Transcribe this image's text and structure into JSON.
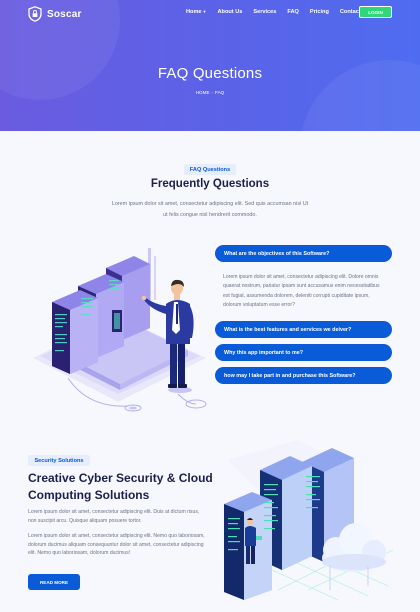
{
  "header": {
    "brand": "Soscar",
    "nav": [
      {
        "label": "Home",
        "has_dropdown": true
      },
      {
        "label": "About Us"
      },
      {
        "label": "Services"
      },
      {
        "label": "FAQ"
      },
      {
        "label": "Pricing"
      },
      {
        "label": "Contact"
      }
    ],
    "login_label": "LOGIN"
  },
  "hero": {
    "title": "FAQ Questions",
    "breadcrumb": {
      "home": "HOME",
      "separator": "-",
      "current": "FAQ"
    }
  },
  "faq": {
    "badge": "FAQ Questions",
    "title": "Frequently Questions",
    "description": "Lorem ipsum dolor sit amet, consectetur adipiscing elit. Sed quis accumsan nisi Ut ut felis congue nisl hendrerit commodo.",
    "items": [
      {
        "question": "What are the objectives of this Software?",
        "expanded": true,
        "answer": "Lorem ipsum dolor sit amet, consectetur adipiscing elit. Dolore omnis quaerat nostrum, pariatur ipsam sunt accusamus enim necessitatibus est fugiat, assumenda dolorem, deleniti corrupti cupiditate ipsum, dolorum voluptatum esse error?"
      },
      {
        "question": "What is the best features and services we deiver?",
        "expanded": false
      },
      {
        "question": "Why this app important to me?",
        "expanded": false
      },
      {
        "question": "how may I take part in and purchase this Software?",
        "expanded": false
      }
    ]
  },
  "cyber": {
    "badge": "Security Solutions",
    "title": "Creative Cyber Security & Cloud Computing Solutions",
    "paragraph1": "Lorem ipsum dolor sit amet, consectetur adipiscing elit. Duis at dictum risus, non suscipit arcu. Quisque aliquam posuere tortor.",
    "paragraph2": "Lorem ipsum dolor sit amet, consectetur adipiscing elit. Nemo quo laboriosam, dolorum ducimus aliquam consequuntur dolor sit amet, consectetur adipiscing elit. Nemo quo laboriosam, dolorum ducimus!",
    "button_label": "READ MORE"
  },
  "colors": {
    "primary": "#0a5bd8",
    "hero_gradient_start": "#6a5be0",
    "hero_gradient_end": "#4f6cf0",
    "login_green": "#2fd67a",
    "heading": "#1b1f4b",
    "body_text": "#6c7187",
    "badge_bg": "#e6eefe"
  },
  "icons": {
    "logo": "shield-lock-icon",
    "nav_dropdown": "caret-down-icon"
  }
}
